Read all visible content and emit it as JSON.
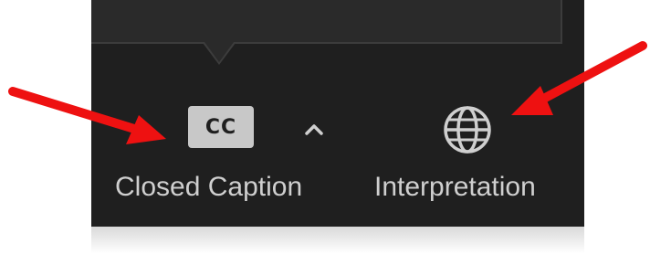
{
  "toolbar": {
    "closed_caption": {
      "icon_text": "CC",
      "label": "Closed Caption",
      "icon": "closed-caption-icon"
    },
    "caret": {
      "icon": "chevron-up-icon"
    },
    "interpretation": {
      "label": "Interpretation",
      "icon": "globe-icon"
    }
  },
  "colors": {
    "toolbar_bg": "#1f1f1f",
    "label_text": "#cfcfcf",
    "cc_badge": "#c8c8c8",
    "annotation_arrow": "#ee1111"
  },
  "annotations": {
    "arrows": [
      "arrow-to-closed-caption",
      "arrow-to-interpretation"
    ]
  }
}
